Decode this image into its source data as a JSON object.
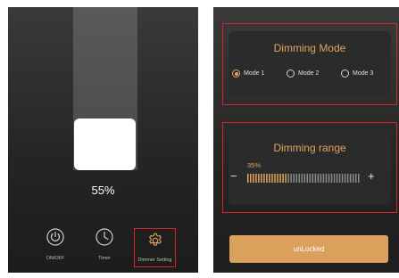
{
  "left_panel": {
    "brightness_percent_label": "55%",
    "brightness_level": 0.55,
    "nav": [
      {
        "label": "ON/OFF",
        "icon": "power-icon"
      },
      {
        "label": "Timer",
        "icon": "clock-icon"
      },
      {
        "label": "Dimmer Setting",
        "icon": "gear-icon",
        "selected": true
      }
    ]
  },
  "right_panel": {
    "dimming_mode": {
      "title": "Dimming Mode",
      "options": [
        "Mode 1",
        "Mode 2",
        "Mode 3"
      ],
      "selected": "Mode 1"
    },
    "dimming_range": {
      "title": "Dimming range",
      "value_label": "35%",
      "value": 0.35,
      "minus_label": "−",
      "plus_label": "+"
    },
    "unlock_button": "unLocked"
  },
  "colors": {
    "accent": "#e0a35d",
    "highlight_border": "#d9232b",
    "button": "#dba05b"
  }
}
